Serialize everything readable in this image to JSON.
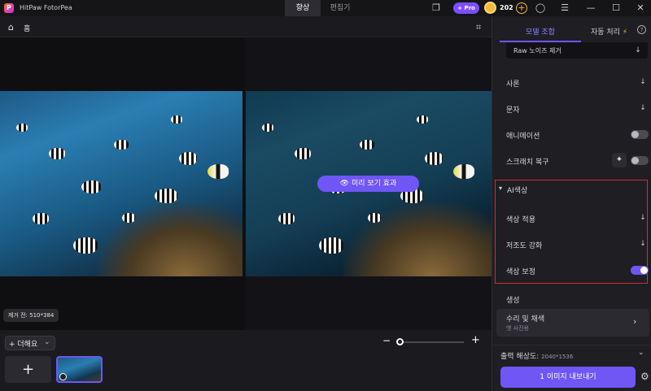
{
  "app": {
    "title": "HitPaw FotorPea",
    "logo_letter": "P"
  },
  "top_tabs": [
    {
      "label": "향상",
      "active": true
    },
    {
      "label": "편집기",
      "active": false
    }
  ],
  "titlebar": {
    "pro_label": "+ Pro",
    "coins": "202",
    "coin_add": "+"
  },
  "subbar": {
    "home_label": "홈"
  },
  "canvas": {
    "preview_button": "미리 보기 효과",
    "size_badge": "제거 전: 510*384"
  },
  "bottom": {
    "add_label": "+ 더해요",
    "zoom_minus": "−",
    "zoom_plus": "+"
  },
  "panel": {
    "tabs": [
      {
        "label": "모델 조합",
        "active": true
      },
      {
        "label": "자동 처리",
        "active": false
      }
    ],
    "raw_label": "Raw 노이즈 제거",
    "items": [
      {
        "label": "사론",
        "control": "download"
      },
      {
        "label": "문자",
        "control": "download"
      },
      {
        "label": "애니메이션",
        "control": "toggle",
        "on": false
      },
      {
        "label": "스크래치 복구",
        "control": "toggle",
        "on": false
      }
    ],
    "ai_section": {
      "title": "AI색상",
      "items": [
        {
          "label": "색상 적용",
          "control": "download"
        },
        {
          "label": "저조도 강화",
          "control": "download"
        },
        {
          "label": "색상 보정",
          "control": "toggle",
          "on": true
        }
      ]
    },
    "gen_label": "생성",
    "group": {
      "title": "수리 및 채색",
      "subtitle": "옛 사진용"
    },
    "output": {
      "label": "출력 해상도:",
      "value": "2040*1536"
    },
    "export_label": "1 이미지 내보내기"
  },
  "colors": {
    "accent": "#6f56f5",
    "highlight_box": "#d42a3a"
  }
}
